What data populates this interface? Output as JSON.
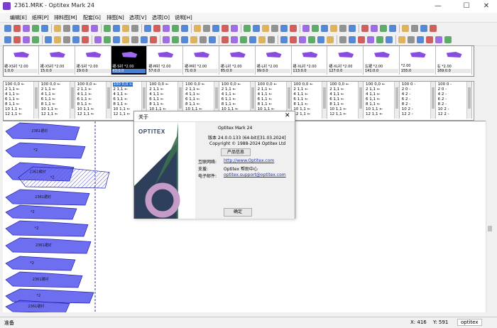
{
  "window": {
    "title": "2361.MRK - Optitex Mark 24",
    "minimize": "—",
    "maximize": "☐",
    "close": "✕"
  },
  "menu": [
    "编辑[E]",
    "纸样[P]",
    "排料图[M]",
    "配套[G]",
    "排图[N]",
    "选项[V]",
    "选项[O]",
    "说明[H]"
  ],
  "thumbnails": [
    {
      "label": "裙-XS衬 *2.00",
      "count": "1:0.0",
      "selected": false
    },
    {
      "label": "裙-XS衬 *2.00",
      "count": "15:0.0",
      "selected": false
    },
    {
      "label": "裙-S衬 *2.00",
      "count": "29:0.0",
      "selected": false
    },
    {
      "label": "裙-S衬 *2.00",
      "count": "43:0.0",
      "selected": true
    },
    {
      "label": "裙-M衬 *2.00",
      "count": "57:0.0",
      "selected": false
    },
    {
      "label": "裙-M衬 *2.00",
      "count": "71:0.0",
      "selected": false
    },
    {
      "label": "裙-L衬 *2.00",
      "count": "85:0.0",
      "selected": false
    },
    {
      "label": "裙-L衬 *2.00",
      "count": "99:0.0",
      "selected": false
    },
    {
      "label": "裙-XL衬 *2.00",
      "count": "113:0.0",
      "selected": false
    },
    {
      "label": "裙-XL衬 *2.00",
      "count": "127:0.0",
      "selected": false
    },
    {
      "label": "左裙 *2.00",
      "count": "141:0.0",
      "selected": false
    },
    {
      "label": "*2.00",
      "count": "155:0",
      "selected": false
    },
    {
      "label": "右 *2.00",
      "count": "169:0.0",
      "selected": false
    }
  ],
  "size_columns": [
    {
      "rows": [
        "100 0,0 ←",
        "2  1,1 ←",
        "4  1,1 ←",
        "6  1,1 ←",
        "8  1,1 ←",
        "10 1,1 ←",
        "12 1,1 ←"
      ],
      "highlight": false
    },
    {
      "rows": [
        "100 0,0 ←",
        "2  1,1 ←",
        "4  1,1 ←",
        "6  1,1 ←",
        "8  1,1 ←",
        "10 1,1 ←",
        "12 1,1 ←"
      ],
      "highlight": false
    },
    {
      "rows": [
        "100 0,0 ←",
        "2  1,1 ←",
        "4  1,1 ←",
        "6  1,1 ←",
        "8  1,1 ←",
        "10 1,1 ←",
        "12 1,1 ←"
      ],
      "highlight": false
    },
    {
      "rows": [
        "100 0,0 ←",
        "2  1,1 ←",
        "4  1,1 ←",
        "6  1,1 ←",
        "8  1,1 ←",
        "10 1,1 ←",
        "12 1,1 ←"
      ],
      "highlight": true
    },
    {
      "rows": [
        "100 0,0 ←",
        "2  1,1 ←",
        "4  1,1 ←",
        "6  1,1 ←",
        "8  1,1 ←",
        "10 1,1 ←",
        "12 1,1 ←"
      ],
      "highlight": false
    },
    {
      "rows": [
        "100 0,0 ←",
        "2  1,1 ←",
        "4  1,1 ←",
        "6  1,1 ←",
        "8  1,1 ←",
        "10 1,1 ←",
        "12 1,1 ←"
      ],
      "highlight": false
    },
    {
      "rows": [
        "100 0,0 ←",
        "2  1,1 ←",
        "4  1,1 ←",
        "6  1,1 ←",
        "8  1,1 ←",
        "10 1,1 ←",
        "12 1,1 ←"
      ],
      "highlight": false
    },
    {
      "rows": [
        "100 0,0 ←",
        "2  1,1 ←",
        "4  1,1 ←",
        "6  1,1 ←",
        "8  1,1 ←",
        "10 1,1 ←",
        "12 1,1 ←"
      ],
      "highlight": false
    },
    {
      "rows": [
        "100 0,0 ←",
        "2  1,1 ←",
        "4  1,1 ←",
        "6  1,1 ←",
        "8  1,1 ←",
        "10 1,1 ←",
        "12 1,1 ←"
      ],
      "highlight": false
    },
    {
      "rows": [
        "100 0,0 ←",
        "2  1,1 ←",
        "4  1,1 ←",
        "6  1,1 ←",
        "8  1,1 ←",
        "10 1,1 ←",
        "12 1,1 ←"
      ],
      "highlight": false
    },
    {
      "rows": [
        "100 0,0 ←",
        "2  1,1 ←",
        "4  1,1 ←",
        "6  1,1 ←",
        "8  1,1 ←",
        "10 1,1 ←",
        "12 1,1 ←"
      ],
      "highlight": false
    },
    {
      "rows": [
        "100 0 -",
        "2  0 -",
        "4  2 -",
        "6  2 -",
        "8  2 -",
        "10 2 -",
        "12 2 -"
      ],
      "highlight": false
    },
    {
      "rows": [
        "100 0 -",
        "2  0 -",
        "4  2 -",
        "6  2 -",
        "8  2 -",
        "10 2 -",
        "12 2 -"
      ],
      "highlight": false
    }
  ],
  "marker": {
    "piece_color": "#5555ee",
    "piece_labels": [
      "2361裙衬",
      "*2",
      "2361裙衬",
      "*2",
      "2361裙衬",
      "*2",
      "*2",
      "2361裙衬",
      "*2",
      "2361裙衬",
      "*2",
      "2361裙衬",
      "*2",
      "2361裙衬"
    ]
  },
  "dialog": {
    "title": "关于",
    "close": "✕",
    "logo": "OPTITEX",
    "product": "Optitex Mark 24",
    "version": "版本 24.0.0.133  (64-bit)[31.03.2024]",
    "copyright": "Copyright © 1988-2024 Optitex Ltd",
    "product_info_button": "产品信息",
    "website_label": "互联网络:",
    "website_link": "http://www.Optitex.com",
    "support_label": "支援:",
    "support_value": "Optitex 帮助中心",
    "email_label": "电子邮件:",
    "email_link": "optitex.support@optitex.com",
    "ok_button": "确定"
  },
  "status": {
    "left": "准备",
    "x": "X: 416",
    "y": "Y: 591",
    "app": "optitex"
  },
  "colors": {
    "accent": "#8a4ce0",
    "piece": "#5555ee",
    "link": "#1a2eb8"
  }
}
